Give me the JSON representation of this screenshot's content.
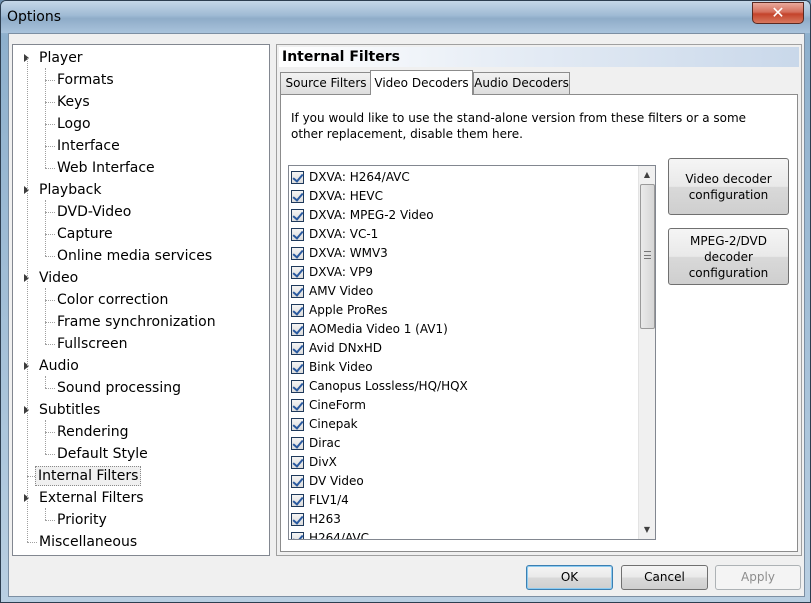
{
  "window": {
    "title": "Options",
    "close_glyph": "✕"
  },
  "tree": {
    "items": [
      {
        "label": "Player",
        "level": 0
      },
      {
        "label": "Formats",
        "level": 1
      },
      {
        "label": "Keys",
        "level": 1
      },
      {
        "label": "Logo",
        "level": 1
      },
      {
        "label": "Interface",
        "level": 1
      },
      {
        "label": "Web Interface",
        "level": 1
      },
      {
        "label": "Playback",
        "level": 0
      },
      {
        "label": "DVD-Video",
        "level": 1
      },
      {
        "label": "Capture",
        "level": 1
      },
      {
        "label": "Online media services",
        "level": 1
      },
      {
        "label": "Video",
        "level": 0
      },
      {
        "label": "Color correction",
        "level": 1
      },
      {
        "label": "Frame synchronization",
        "level": 1
      },
      {
        "label": "Fullscreen",
        "level": 1
      },
      {
        "label": "Audio",
        "level": 0
      },
      {
        "label": "Sound processing",
        "level": 1
      },
      {
        "label": "Subtitles",
        "level": 0
      },
      {
        "label": "Rendering",
        "level": 1
      },
      {
        "label": "Default Style",
        "level": 1
      },
      {
        "label": "Internal Filters",
        "level": 0
      },
      {
        "label": "External Filters",
        "level": 0
      },
      {
        "label": "Priority",
        "level": 1
      },
      {
        "label": "Miscellaneous",
        "level": 0
      }
    ]
  },
  "panel": {
    "title": "Internal Filters",
    "tabs": [
      {
        "label": "Source Filters"
      },
      {
        "label": "Video Decoders"
      },
      {
        "label": "Audio Decoders"
      }
    ],
    "active_tab": "Video Decoders",
    "description": "If you would like to use the stand-alone version from these filters or a some other replacement, disable them here.",
    "filters": [
      {
        "label": "DXVA: H264/AVC",
        "checked": true
      },
      {
        "label": "DXVA: HEVC",
        "checked": true
      },
      {
        "label": "DXVA: MPEG-2 Video",
        "checked": true
      },
      {
        "label": "DXVA: VC-1",
        "checked": true
      },
      {
        "label": "DXVA: WMV3",
        "checked": true
      },
      {
        "label": "DXVA: VP9",
        "checked": true
      },
      {
        "label": "AMV Video",
        "checked": true
      },
      {
        "label": "Apple ProRes",
        "checked": true
      },
      {
        "label": "AOMedia Video 1 (AV1)",
        "checked": true
      },
      {
        "label": "Avid DNxHD",
        "checked": true
      },
      {
        "label": "Bink Video",
        "checked": true
      },
      {
        "label": "Canopus Lossless/HQ/HQX",
        "checked": true
      },
      {
        "label": "CineForm",
        "checked": true
      },
      {
        "label": "Cinepak",
        "checked": true
      },
      {
        "label": "Dirac",
        "checked": true
      },
      {
        "label": "DivX",
        "checked": true
      },
      {
        "label": "DV Video",
        "checked": true
      },
      {
        "label": "FLV1/4",
        "checked": true
      },
      {
        "label": "H263",
        "checked": true
      },
      {
        "label": "H264/AVC",
        "checked": true
      }
    ],
    "video_decoder_button": "Video decoder configuration",
    "mpeg2_button": "MPEG-2/DVD decoder configuration"
  },
  "footer": {
    "ok": "OK",
    "cancel": "Cancel",
    "apply": "Apply"
  }
}
